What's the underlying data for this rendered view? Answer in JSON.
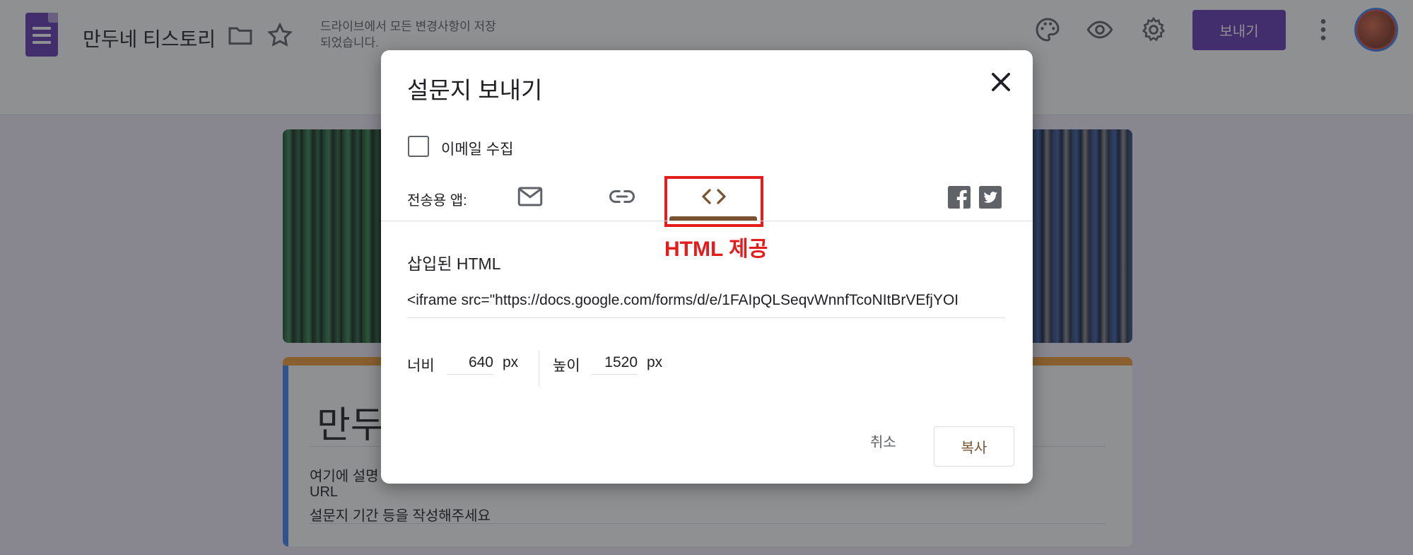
{
  "app": {
    "doc_title": "만두네 티스토리",
    "save_status": "드라이브에서 모든 변경사항이 저장되었습니다.",
    "send_label": "보내기",
    "icons": [
      "forms-logo-icon",
      "folder-icon",
      "star-icon",
      "palette-icon",
      "eye-icon",
      "gear-icon",
      "more-vert-icon"
    ],
    "accent": "#673ab7"
  },
  "form": {
    "title_partial": "만두",
    "description_lines": [
      "여기에 설명",
      "URL",
      "설문지 기간 등을 작성해주세요"
    ]
  },
  "dialog": {
    "title": "설문지 보내기",
    "collect_email_label": "이메일 수집",
    "send_via_label": "전송용 앱:",
    "tabs": [
      {
        "name": "email",
        "icon": "mail-icon"
      },
      {
        "name": "link",
        "icon": "link-icon"
      },
      {
        "name": "embed",
        "icon": "code-icon",
        "selected": true
      }
    ],
    "share_icons": [
      "facebook-icon",
      "twitter-icon"
    ],
    "annotation": "HTML 제공",
    "embed_section_title": "삽입된 HTML",
    "embed_code": "<iframe src=\"https://docs.google.com/forms/d/e/1FAIpQLSeqvWnnfTcoNItBrVEfjYOI",
    "width_label": "너비",
    "width_value": "640",
    "height_label": "높이",
    "height_value": "1520",
    "unit": "px",
    "cancel_label": "취소",
    "copy_label": "복사",
    "highlight_color": "#e51c1c"
  }
}
